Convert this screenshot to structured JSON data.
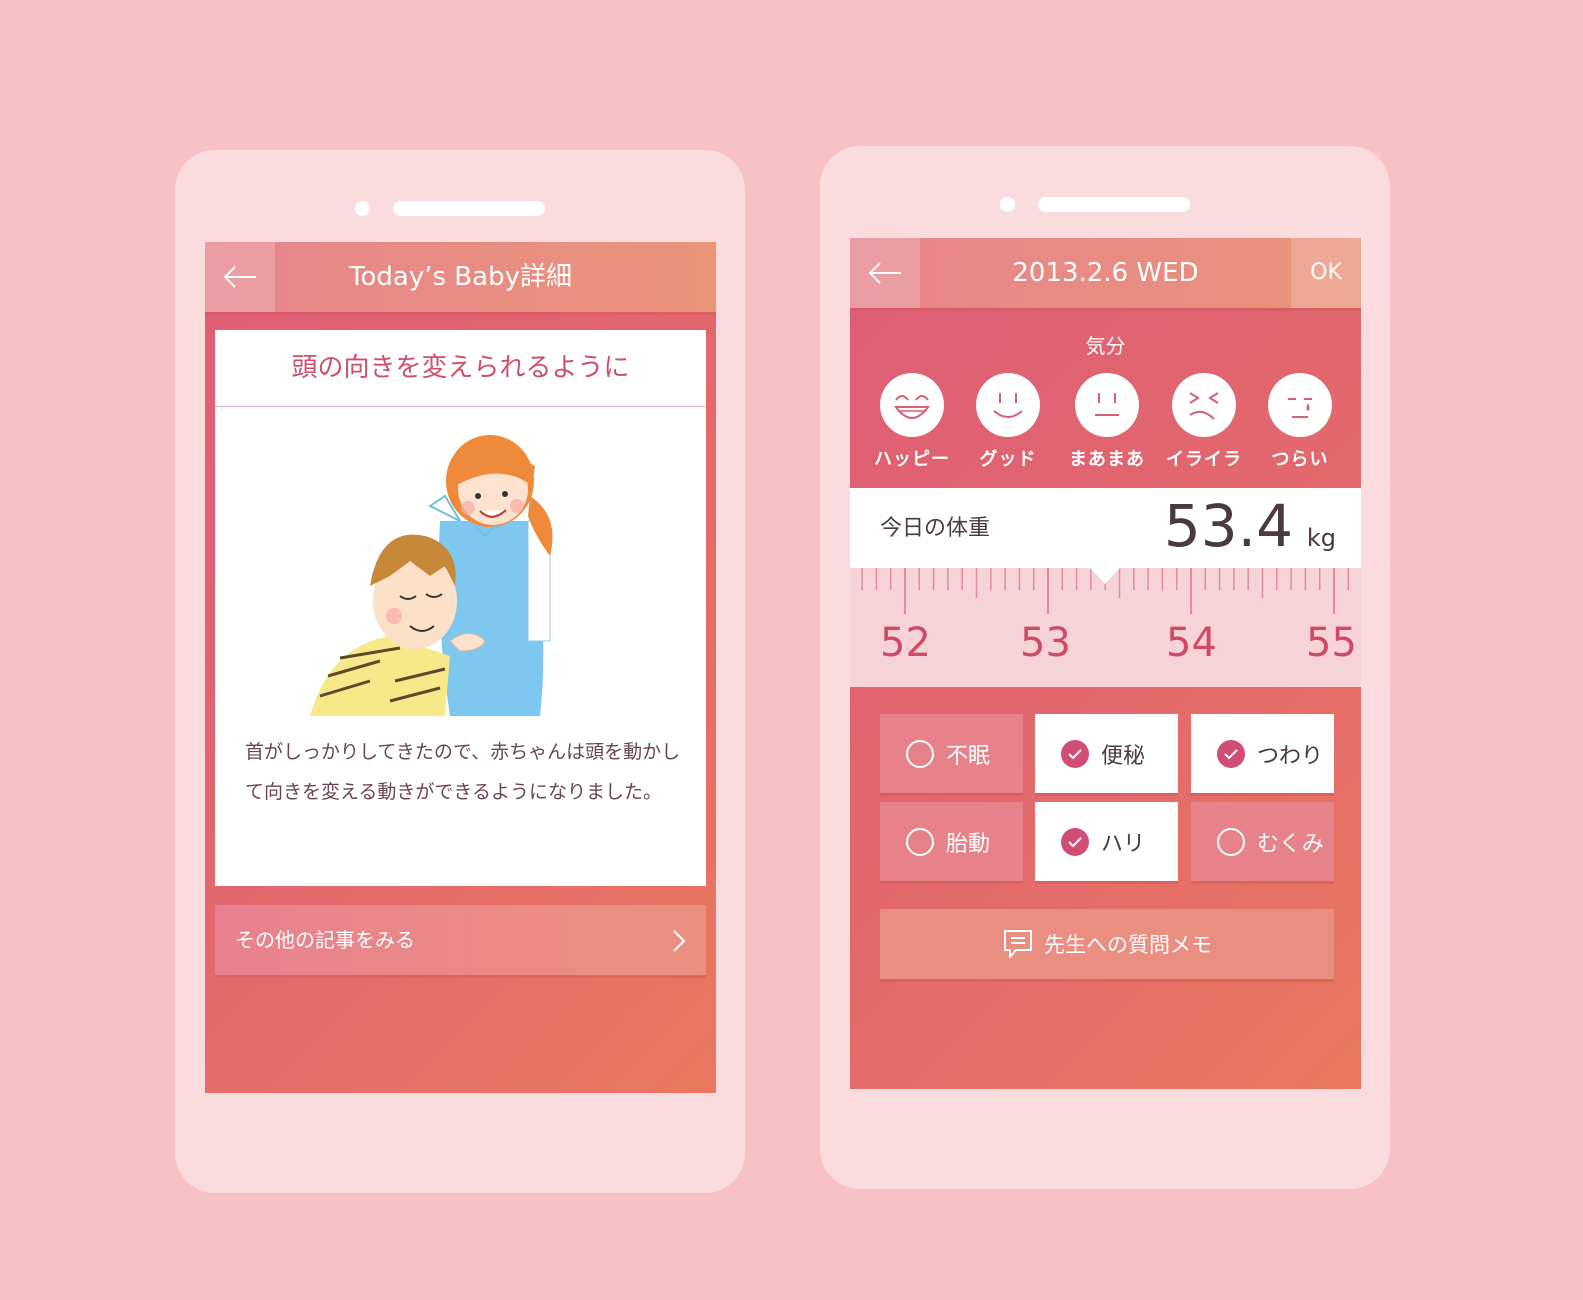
{
  "left_screen": {
    "header_title": "Today’s Baby詳細",
    "article_title": "頭の向きを変えられるように",
    "article_body": "首がしっかりしてきたので、赤ちゃんは頭を動かして向きを変える動きができるようになりました。",
    "more_label": "その他の記事をみる"
  },
  "right_screen": {
    "date": "2013.2.6  WED",
    "ok_label": "OK",
    "mood_label": "気分",
    "moods": [
      {
        "name": "ハッピー",
        "icon": "happy-face-icon"
      },
      {
        "name": "グッド",
        "icon": "smile-face-icon"
      },
      {
        "name": "まあまあ",
        "icon": "neutral-face-icon"
      },
      {
        "name": "イライラ",
        "icon": "irritated-face-icon"
      },
      {
        "name": "つらい",
        "icon": "sad-face-icon"
      }
    ],
    "weight_label": "今日の体重",
    "weight_value": "53.4",
    "weight_unit": "kg",
    "ruler_labels": [
      "52",
      "53",
      "54",
      "55"
    ],
    "symptoms": [
      {
        "label": "不眠",
        "checked": false
      },
      {
        "label": "便秘",
        "checked": true
      },
      {
        "label": "つわり",
        "checked": true
      },
      {
        "label": "胎動",
        "checked": false
      },
      {
        "label": "ハリ",
        "checked": true
      },
      {
        "label": "むくみ",
        "checked": false
      }
    ],
    "memo_label": "先生への質問メモ"
  },
  "colors": {
    "background": "#f8c1c5",
    "phone": "#fbdcde",
    "accent": "#d14d73",
    "gradient_start": "#de5d76",
    "gradient_end": "#e9785e"
  }
}
